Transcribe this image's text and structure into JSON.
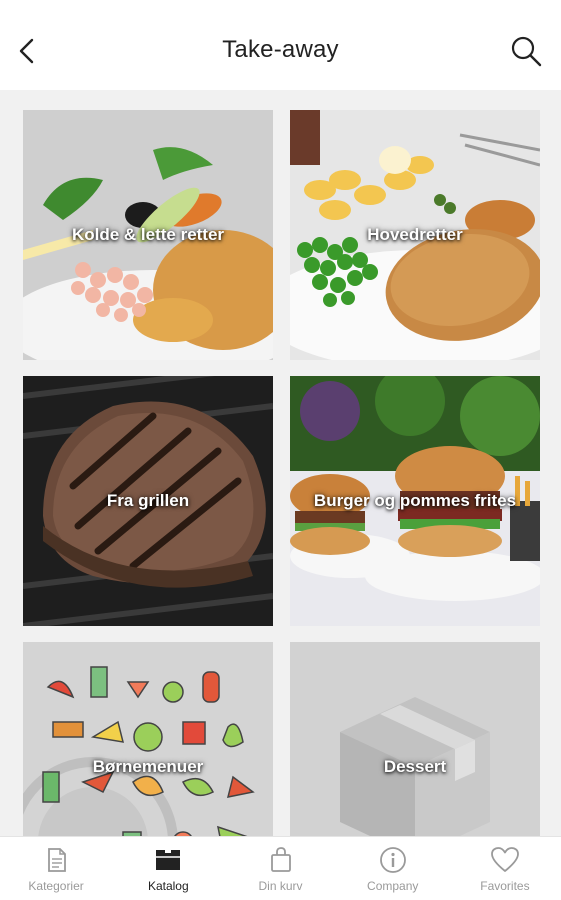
{
  "header": {
    "title": "Take-away",
    "back_icon": "chevron-left-icon",
    "search_icon": "search-icon"
  },
  "categories": [
    {
      "label": "Kolde & lette retter"
    },
    {
      "label": "Hovedretter"
    },
    {
      "label": "Fra grillen"
    },
    {
      "label": "Burger og pommes frites"
    },
    {
      "label": "Børnemenuer"
    },
    {
      "label": "Dessert"
    }
  ],
  "bottom_nav": {
    "items": [
      {
        "label": "Kategorier",
        "icon": "document-icon",
        "active": false
      },
      {
        "label": "Katalog",
        "icon": "catalog-icon",
        "active": true
      },
      {
        "label": "Din kurv",
        "icon": "bag-icon",
        "active": false
      },
      {
        "label": "Company",
        "icon": "info-icon",
        "active": false
      },
      {
        "label": "Favorites",
        "icon": "heart-icon",
        "active": false
      }
    ]
  },
  "colors": {
    "active_nav": "#222222",
    "inactive_nav": "#9a9a9a",
    "grid_background": "#f1f1f1"
  }
}
